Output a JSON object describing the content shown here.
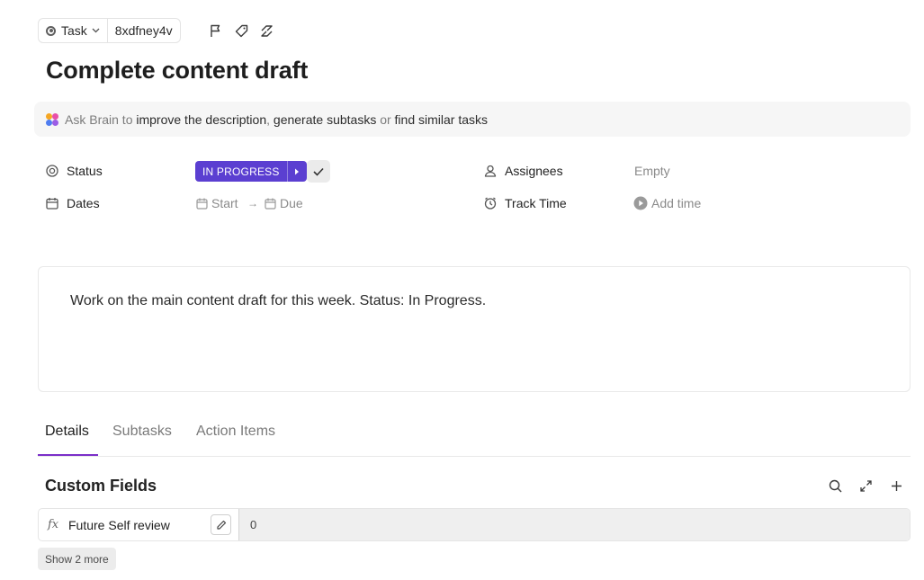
{
  "toolbar": {
    "type_label": "Task",
    "task_id": "8xdfney4v",
    "icons": [
      "flag-icon",
      "tag-icon",
      "link-icon"
    ]
  },
  "task": {
    "title": "Complete content draft"
  },
  "brain": {
    "prefix": "Ask Brain to",
    "action_1": "improve the description",
    "separator": ",",
    "action_2": "generate subtasks",
    "connector": "or",
    "action_3": "find similar tasks"
  },
  "properties": {
    "status": {
      "label": "Status",
      "value": "IN PROGRESS",
      "color": "#5b3fd1"
    },
    "dates": {
      "label": "Dates",
      "start": "Start",
      "arrow": "→",
      "due": "Due"
    },
    "assignees": {
      "label": "Assignees",
      "value": "Empty"
    },
    "track_time": {
      "label": "Track Time",
      "value": "Add time"
    }
  },
  "description": {
    "text": "Work on the main content draft for this week. Status: In Progress."
  },
  "tabs": [
    {
      "label": "Details",
      "active": true
    },
    {
      "label": "Subtasks",
      "active": false
    },
    {
      "label": "Action Items",
      "active": false
    }
  ],
  "custom_fields": {
    "title": "Custom Fields",
    "fields": [
      {
        "name": "Future Self review",
        "value": "0"
      }
    ],
    "show_more_label": "Show 2 more"
  },
  "colors": {
    "accent": "#5b3fd1",
    "tab_underline": "#7b2fc9"
  }
}
